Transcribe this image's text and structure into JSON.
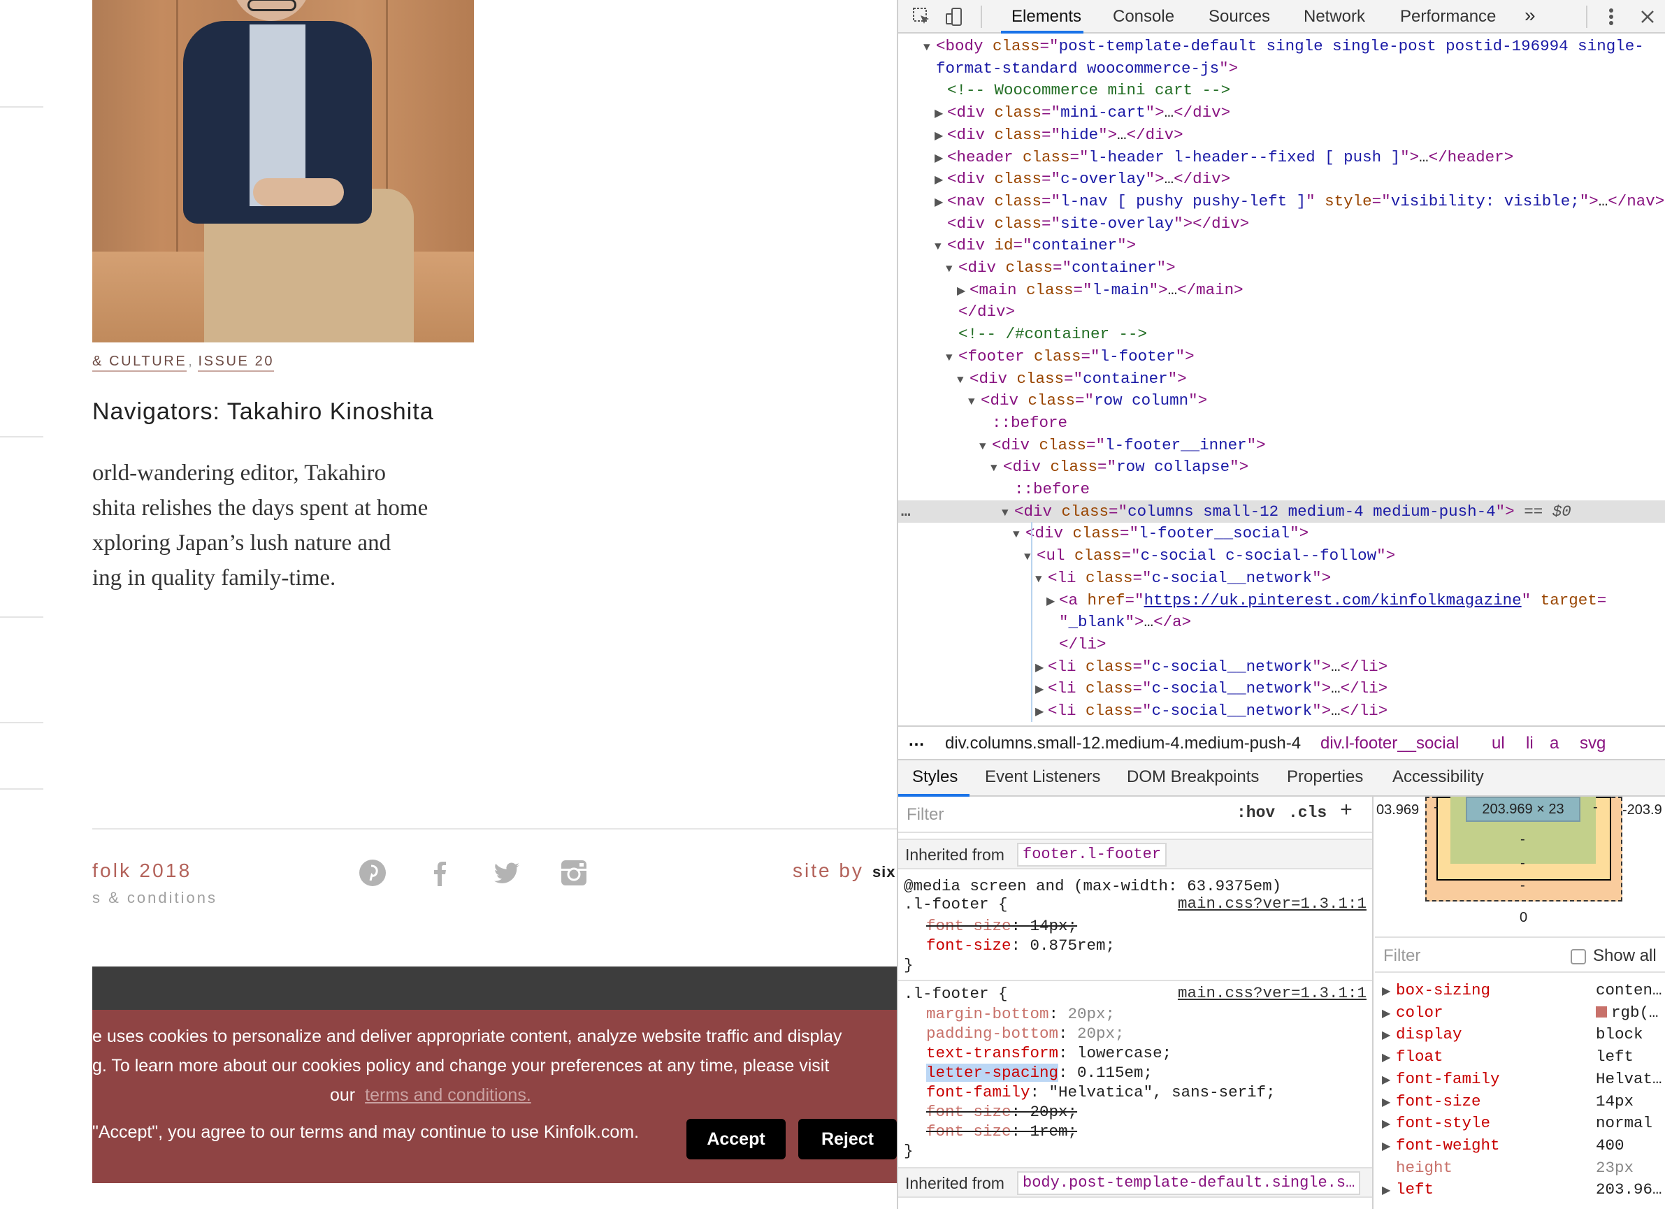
{
  "site": {
    "categories": [
      "& CULTURE",
      "ISSUE 20"
    ],
    "category_separator": ",",
    "article_title": "Navigators: Takahiro Kinoshita",
    "excerpt_lines": [
      "orld-wandering editor, Takahiro",
      "shita relishes the days spent at home",
      "xploring Japan’s lush nature and",
      "ing in quality family-time."
    ],
    "footer": {
      "copyright": "folk 2018",
      "terms": "s & conditions",
      "social_icons": [
        "pinterest-icon",
        "facebook-icon",
        "twitter-icon",
        "instagram-icon"
      ],
      "site_by": "site by",
      "site_by_name": "six"
    },
    "cookie": {
      "line1": "e uses cookies to personalize and deliver appropriate content, analyze website traffic and display",
      "line2": "g. To learn more about our cookies policy and change your preferences at any time, please visit",
      "line3_prefix": "our",
      "line3_link": "terms and conditions.",
      "line4": "\"Accept\", you agree to our terms and may continue to use Kinfolk.com.",
      "accept_label": "Accept",
      "reject_label": "Reject"
    }
  },
  "devtools": {
    "tabs": [
      "Elements",
      "Console",
      "Sources",
      "Network",
      "Performance"
    ],
    "active_tab": "Elements",
    "more_tabs_glyph": "»",
    "dom_lines": [
      {
        "indent": 1,
        "arrow": "open",
        "html": "<span class='tag'>&lt;body</span> <span class='attr'>class</span><span class='tag'>=\"</span><span class='val'>post-template-default single single-post postid-196994 single-</span>"
      },
      {
        "indent": 1,
        "arrow": "none",
        "html": "<span class='val'>format-standard woocommerce-js</span><span class='tag'>\"&gt;</span>"
      },
      {
        "indent": 2,
        "arrow": "none",
        "html": "<span class='cm'>&lt;!-- Woocommerce mini cart --&gt;</span>"
      },
      {
        "indent": 2,
        "arrow": "closed",
        "html": "<span class='tag'>&lt;div</span> <span class='attr'>class</span><span class='tag'>=\"</span><span class='val'>mini-cart</span><span class='tag'>\"&gt;</span><span class='plain'>…</span><span class='tag'>&lt;/div&gt;</span>"
      },
      {
        "indent": 2,
        "arrow": "closed",
        "html": "<span class='tag'>&lt;div</span> <span class='attr'>class</span><span class='tag'>=\"</span><span class='val'>hide</span><span class='tag'>\"&gt;</span><span class='plain'>…</span><span class='tag'>&lt;/div&gt;</span>"
      },
      {
        "indent": 2,
        "arrow": "closed",
        "html": "<span class='tag'>&lt;header</span> <span class='attr'>class</span><span class='tag'>=\"</span><span class='val'>l-header l-header--fixed [ push ]</span><span class='tag'>\"&gt;</span><span class='plain'>…</span><span class='tag'>&lt;/header&gt;</span>"
      },
      {
        "indent": 2,
        "arrow": "closed",
        "html": "<span class='tag'>&lt;div</span> <span class='attr'>class</span><span class='tag'>=\"</span><span class='val'>c-overlay</span><span class='tag'>\"&gt;</span><span class='plain'>…</span><span class='tag'>&lt;/div&gt;</span>"
      },
      {
        "indent": 2,
        "arrow": "closed",
        "html": "<span class='tag'>&lt;nav</span> <span class='attr'>class</span><span class='tag'>=\"</span><span class='val'>l-nav [ pushy pushy-left ]</span><span class='tag'>\"</span> <span class='attr'>style</span><span class='tag'>=\"</span><span class='val'>visibility: visible;</span><span class='tag'>\"&gt;</span><span class='plain'>…</span><span class='tag'>&lt;/nav&gt;</span>"
      },
      {
        "indent": 2,
        "arrow": "none",
        "html": "<span class='tag'>&lt;div</span> <span class='attr'>class</span><span class='tag'>=\"</span><span class='val'>site-overlay</span><span class='tag'>\"&gt;&lt;/div&gt;</span>"
      },
      {
        "indent": 2,
        "arrow": "open",
        "html": "<span class='tag'>&lt;div</span> <span class='attr'>id</span><span class='tag'>=\"</span><span class='val'>container</span><span class='tag'>\"&gt;</span>"
      },
      {
        "indent": 3,
        "arrow": "open",
        "html": "<span class='tag'>&lt;div</span> <span class='attr'>class</span><span class='tag'>=\"</span><span class='val'>container</span><span class='tag'>\"&gt;</span>"
      },
      {
        "indent": 4,
        "arrow": "closed",
        "html": "<span class='tag'>&lt;main</span> <span class='attr'>class</span><span class='tag'>=\"</span><span class='val'>l-main</span><span class='tag'>\"&gt;</span><span class='plain'>…</span><span class='tag'>&lt;/main&gt;</span>"
      },
      {
        "indent": 3,
        "arrow": "none",
        "html": "<span class='tag'>&lt;/div&gt;</span>"
      },
      {
        "indent": 3,
        "arrow": "none",
        "html": "<span class='cm'>&lt;!-- /#container --&gt;</span>"
      },
      {
        "indent": 3,
        "arrow": "open",
        "html": "<span class='tag'>&lt;footer</span> <span class='attr'>class</span><span class='tag'>=\"</span><span class='val'>l-footer</span><span class='tag'>\"&gt;</span>"
      },
      {
        "indent": 4,
        "arrow": "open",
        "html": "<span class='tag'>&lt;div</span> <span class='attr'>class</span><span class='tag'>=\"</span><span class='val'>container</span><span class='tag'>\"&gt;</span>"
      },
      {
        "indent": 5,
        "arrow": "open",
        "html": "<span class='tag'>&lt;div</span> <span class='attr'>class</span><span class='tag'>=\"</span><span class='val'>row column</span><span class='tag'>\"&gt;</span>"
      },
      {
        "indent": 6,
        "arrow": "none",
        "html": "<span class='ps'>::before</span>"
      },
      {
        "indent": 6,
        "arrow": "open",
        "html": "<span class='tag'>&lt;div</span> <span class='attr'>class</span><span class='tag'>=\"</span><span class='val'>l-footer__inner</span><span class='tag'>\"&gt;</span>"
      },
      {
        "indent": 7,
        "arrow": "open",
        "html": "<span class='tag'>&lt;div</span> <span class='attr'>class</span><span class='tag'>=\"</span><span class='val'>row collapse</span><span class='tag'>\"&gt;</span>"
      },
      {
        "indent": 8,
        "arrow": "none",
        "html": "<span class='ps'>::before</span>"
      },
      {
        "indent": 8,
        "arrow": "open",
        "selected": true,
        "html": "<span class='tag'>&lt;div</span> <span class='attr'>class</span><span class='tag'>=\"</span><span class='val'>columns small-12 medium-4 medium-push-4</span><span class='tag'>\"&gt;</span> <span class='eq0'>== $0</span>"
      },
      {
        "indent": 9,
        "arrow": "open",
        "html": "<span class='tag'>&lt;div</span> <span class='attr'>class</span><span class='tag'>=\"</span><span class='val'>l-footer__social</span><span class='tag'>\"&gt;</span>"
      },
      {
        "indent": 10,
        "arrow": "open",
        "html": "<span class='tag'>&lt;ul</span> <span class='attr'>class</span><span class='tag'>=\"</span><span class='val'>c-social c-social--follow</span><span class='tag'>\"&gt;</span>"
      },
      {
        "indent": 11,
        "arrow": "open",
        "html": "<span class='tag'>&lt;li</span> <span class='attr'>class</span><span class='tag'>=\"</span><span class='val'>c-social__network</span><span class='tag'>\"&gt;</span>"
      },
      {
        "indent": 12,
        "arrow": "closed",
        "html": "<span class='tag'>&lt;a</span> <span class='attr'>href</span><span class='tag'>=\"</span><span class='href'>https://uk.pinterest.com/kinfolkmagazine</span><span class='tag'>\"</span> <span class='attr'>target</span><span class='tag'>=</span>"
      },
      {
        "indent": 12,
        "arrow": "none",
        "html": "<span class='tag'>\"</span><span class='val'>_blank</span><span class='tag'>\"&gt;</span><span class='plain'>…</span><span class='tag'>&lt;/a&gt;</span>"
      },
      {
        "indent": 12,
        "arrow": "none",
        "html": "<span class='tag'>&lt;/li&gt;</span>"
      },
      {
        "indent": 11,
        "arrow": "closed",
        "html": "<span class='tag'>&lt;li</span> <span class='attr'>class</span><span class='tag'>=\"</span><span class='val'>c-social__network</span><span class='tag'>\"&gt;</span><span class='plain'>…</span><span class='tag'>&lt;/li&gt;</span>"
      },
      {
        "indent": 11,
        "arrow": "closed",
        "html": "<span class='tag'>&lt;li</span> <span class='attr'>class</span><span class='tag'>=\"</span><span class='val'>c-social__network</span><span class='tag'>\"&gt;</span><span class='plain'>…</span><span class='tag'>&lt;/li&gt;</span>"
      },
      {
        "indent": 11,
        "arrow": "closed",
        "html": "<span class='tag'>&lt;li</span> <span class='attr'>class</span><span class='tag'>=\"</span><span class='val'>c-social__network</span><span class='tag'>\"&gt;</span><span class='plain'>…</span><span class='tag'>&lt;/li&gt;</span>"
      }
    ],
    "breadcrumbs": [
      "div.columns.small-12.medium-4.medium-push-4",
      "div.l-footer__social",
      "ul",
      "li",
      "a",
      "svg"
    ],
    "subtabs": [
      "Styles",
      "Event Listeners",
      "DOM Breakpoints",
      "Properties",
      "Accessibility"
    ],
    "styles": {
      "filter_placeholder": "Filter",
      "hov": ":hov",
      "cls": ".cls",
      "add": "+",
      "inherited_label": "Inherited from",
      "inherited_from_1": "footer.l-footer",
      "media": "@media screen and (max-width: 63.9375em)",
      "rule1_selector": ".l-footer {",
      "rule1_file": "main.css?ver=1.3.1:1",
      "rule1_decls": [
        {
          "prop": "font-size",
          "value": "14px;",
          "struck": true
        },
        {
          "prop": "font-size",
          "value": "0.875rem;",
          "struck": false
        }
      ],
      "close_brace": "}",
      "rule2_selector": ".l-footer {",
      "rule2_file": "main.css?ver=1.3.1:1",
      "rule2_decls": [
        {
          "prop": "margin-bottom",
          "value": "20px;",
          "struck": false,
          "dim": true
        },
        {
          "prop": "padding-bottom",
          "value": "20px;",
          "struck": false,
          "dim": true
        },
        {
          "prop": "text-transform",
          "value": "lowercase;",
          "struck": false
        },
        {
          "prop": "letter-spacing",
          "value": "0.115em;",
          "struck": false,
          "highlight": true
        },
        {
          "prop": "font-family",
          "value": "\"Helvatica\", sans-serif;",
          "struck": false
        },
        {
          "prop": "font-size",
          "value": "20px;",
          "struck": true
        },
        {
          "prop": "font-size",
          "value": "1rem;",
          "struck": true
        }
      ],
      "inherited_from_2": "body.post-template-default.single.s…"
    },
    "computed": {
      "box_left": "03.969",
      "box_right": "-203.9",
      "content_size": "203.969 × 23",
      "padding_val": "-",
      "border_val": "-",
      "margin_val": "-",
      "bottom_val": "0",
      "filter_placeholder": "Filter",
      "show_all": "Show all",
      "props": [
        {
          "name": "box-sizing",
          "value": "conten…"
        },
        {
          "name": "color",
          "value": "rgb(…",
          "swatch": "#c8716a"
        },
        {
          "name": "display",
          "value": "block"
        },
        {
          "name": "float",
          "value": "left"
        },
        {
          "name": "font-family",
          "value": "Helvat…"
        },
        {
          "name": "font-size",
          "value": "14px"
        },
        {
          "name": "font-style",
          "value": "normal"
        },
        {
          "name": "font-weight",
          "value": "400"
        },
        {
          "name": "height",
          "value": "23px",
          "dim": true
        },
        {
          "name": "left",
          "value": "203.96…"
        }
      ]
    }
  }
}
